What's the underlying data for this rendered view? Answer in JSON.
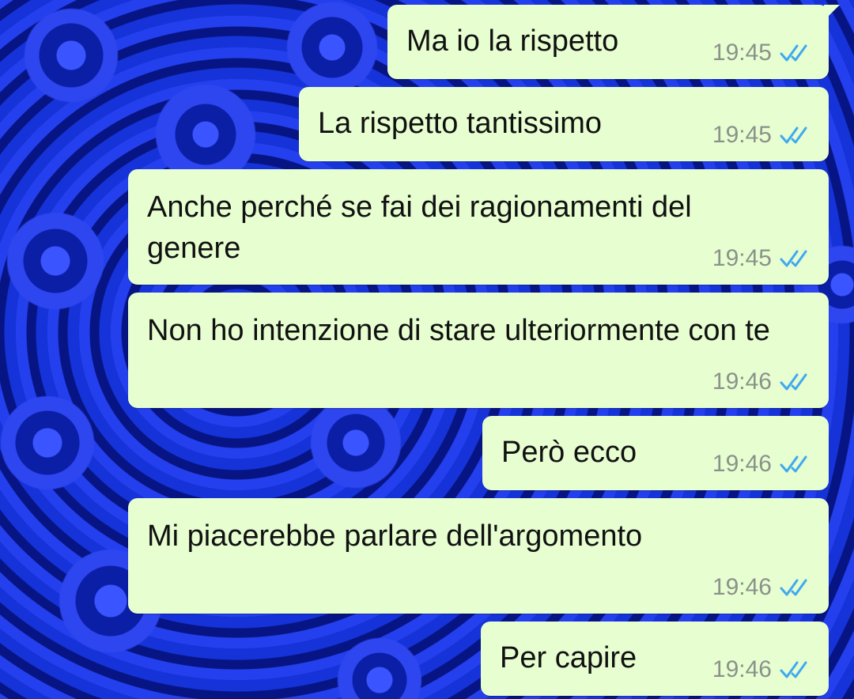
{
  "colors": {
    "bubble": "#e7fed1",
    "text": "#111111",
    "time": "#8a928a",
    "read_ticks": "#3fa9f0",
    "wallpaper": "#0a1ea8"
  },
  "messages": [
    {
      "text": "Ma io la rispetto",
      "time": "19:45",
      "status_icon": "double-check-icon"
    },
    {
      "text": "La rispetto tantissimo",
      "time": "19:45",
      "status_icon": "double-check-icon"
    },
    {
      "text": "Anche perché se fai dei ragionamenti del genere",
      "time": "19:45",
      "status_icon": "double-check-icon"
    },
    {
      "text": "Non ho intenzione di stare ulteriormente con te",
      "time": "19:46",
      "status_icon": "double-check-icon"
    },
    {
      "text": "Però ecco",
      "time": "19:46",
      "status_icon": "double-check-icon"
    },
    {
      "text": "Mi piacerebbe parlare dell'argomento",
      "time": "19:46",
      "status_icon": "double-check-icon"
    },
    {
      "text": "Per capire",
      "time": "19:46",
      "status_icon": "double-check-icon"
    }
  ]
}
